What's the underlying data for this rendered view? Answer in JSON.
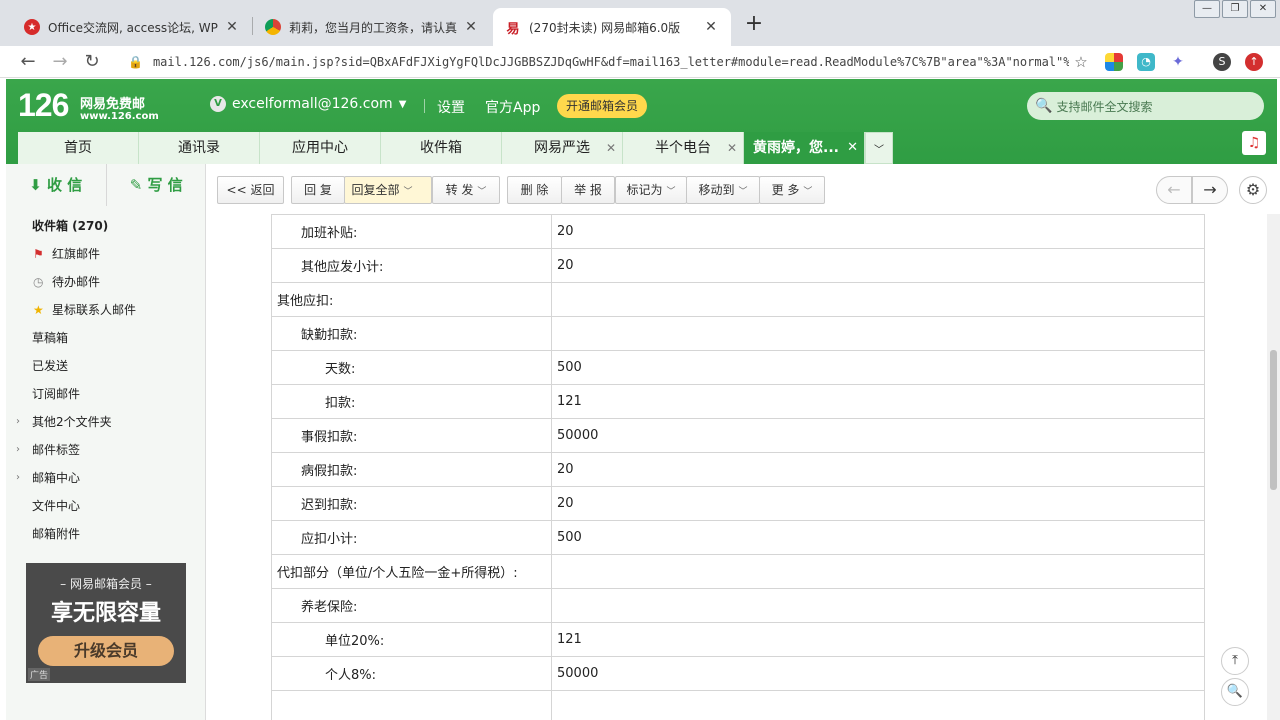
{
  "browser": {
    "tabs": [
      {
        "title": "Office交流网, access论坛, WPS办",
        "icon": "red-star-favicon",
        "color": "#d62b2b"
      },
      {
        "title": "莉莉，您当月的工资条，请认真核",
        "icon": "chrome-favicon",
        "color": "#f0b400"
      },
      {
        "title": "(270封未读) 网易邮箱6.0版",
        "icon": "netease-favicon",
        "color": "#c81d25"
      }
    ],
    "url": "mail.126.com/js6/main.jsp?sid=QBxAFdFJXigYgFQlDcJJGBBSZJDqGwHF&df=mail163_letter#module=read.ReadModule%7C%7B\"area\"%3A\"normal\"%…"
  },
  "mail_header": {
    "logo": "126",
    "logo_sub1": "网易免费邮",
    "logo_sub2": "www.126.com",
    "account": "excelformall@126.com",
    "settings": "设置",
    "app": "官方App",
    "vip": "开通邮箱会员",
    "search_placeholder": "支持邮件全文搜索"
  },
  "nav_tabs": [
    {
      "label": "首页",
      "closable": false
    },
    {
      "label": "通讯录",
      "closable": false
    },
    {
      "label": "应用中心",
      "closable": false
    },
    {
      "label": "收件箱",
      "closable": false
    },
    {
      "label": "网易严选",
      "closable": true
    },
    {
      "label": "半个电台",
      "closable": true
    },
    {
      "label": "黄雨婷，您...",
      "closable": true,
      "active": true
    }
  ],
  "sidebar": {
    "receive": "收 信",
    "compose": "写 信",
    "folders": [
      {
        "label": "收件箱 (270)",
        "bold": true
      },
      {
        "label": "红旗邮件",
        "icon": "red-flag-icon"
      },
      {
        "label": "待办邮件",
        "icon": "clock-icon"
      },
      {
        "label": "星标联系人邮件",
        "icon": "star-icon"
      },
      {
        "label": "草稿箱"
      },
      {
        "label": "已发送"
      },
      {
        "label": "订阅邮件"
      },
      {
        "label": "其他2个文件夹",
        "expand": true
      },
      {
        "label": "邮件标签",
        "expand": true
      },
      {
        "label": "邮箱中心",
        "expand": true
      },
      {
        "label": "文件中心"
      },
      {
        "label": "邮箱附件"
      }
    ],
    "ad": {
      "line1": "– 网易邮箱会员 –",
      "line2": "享无限容量",
      "button": "升级会员",
      "tag": "广告"
    }
  },
  "actions": {
    "back": "<< 返回",
    "reply": "回 复",
    "reply_all": "回复全部",
    "forward": "转 发",
    "delete": "删 除",
    "report": "举 报",
    "mark": "标记为",
    "move": "移动到",
    "more": "更 多"
  },
  "salary_rows": [
    {
      "label": "加班补贴:",
      "value": "20",
      "indent": 1
    },
    {
      "label": "其他应发小计:",
      "value": "20",
      "indent": 1
    },
    {
      "label": "其他应扣:",
      "value": "",
      "indent": 0
    },
    {
      "label": "缺勤扣款:",
      "value": "",
      "indent": 1
    },
    {
      "label": "天数:",
      "value": "500",
      "indent": 2
    },
    {
      "label": "扣款:",
      "value": "121",
      "indent": 2
    },
    {
      "label": "事假扣款:",
      "value": "50000",
      "indent": 1
    },
    {
      "label": "病假扣款:",
      "value": "20",
      "indent": 1
    },
    {
      "label": "迟到扣款:",
      "value": "20",
      "indent": 1
    },
    {
      "label": "应扣小计:",
      "value": "500",
      "indent": 1
    },
    {
      "label": "代扣部分（单位/个人五险一金+所得税）:",
      "value": "",
      "indent": 0
    },
    {
      "label": "养老保险:",
      "value": "",
      "indent": 1
    },
    {
      "label": "单位20%:",
      "value": "121",
      "indent": 2
    },
    {
      "label": "个人8%:",
      "value": "50000",
      "indent": 2
    },
    {
      "label": "",
      "value": "",
      "indent": 0
    }
  ]
}
